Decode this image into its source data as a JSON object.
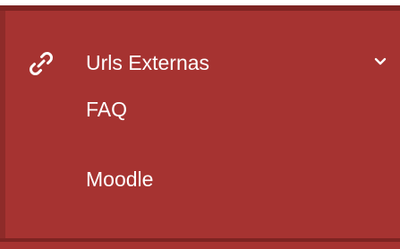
{
  "menu": {
    "header": {
      "label": "Urls Externas",
      "icon": "link-icon",
      "expanded": true
    },
    "items": [
      {
        "label": "FAQ"
      },
      {
        "label": "Moodle"
      }
    ]
  },
  "colors": {
    "panel_background": "#a63331",
    "border": "#7d2422",
    "text": "#ffffff"
  }
}
